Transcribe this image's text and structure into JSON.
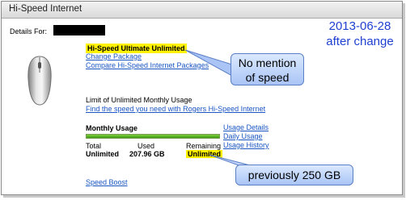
{
  "header": {
    "title": "Hi-Speed Internet"
  },
  "details": {
    "label": "Details For:"
  },
  "annotation": {
    "date": "2013-06-28",
    "note": "after change"
  },
  "plan": {
    "name": "Hi-Speed Ultimate Unlimited",
    "change_link": "Change Package",
    "compare_link": "Compare Hi-Speed Internet Packages"
  },
  "limit": {
    "label": "Limit of Unlimited Monthly Usage",
    "find_link": "Find the speed you need with Rogers Hi-Speed Internet"
  },
  "usage": {
    "title": "Monthly Usage",
    "bar_fraction": 1.0,
    "headers": {
      "total": "Total",
      "used": "Used",
      "remaining": "Remaining"
    },
    "values": {
      "total": "Unlimited",
      "used": "207.96 GB",
      "remaining": "Unlimited"
    },
    "links": {
      "details": "Usage Details",
      "daily": "Daily Usage",
      "history": "Usage History"
    }
  },
  "speed_boost_link": "Speed Boost",
  "callouts": {
    "no_speed_line1": "No mention",
    "no_speed_line2": "of speed",
    "previous": "previously 250 GB"
  },
  "colors": {
    "highlight": "#fff200",
    "link": "#1a56c4",
    "annotation": "#1f3fd0",
    "bar": "#3e9a12"
  }
}
